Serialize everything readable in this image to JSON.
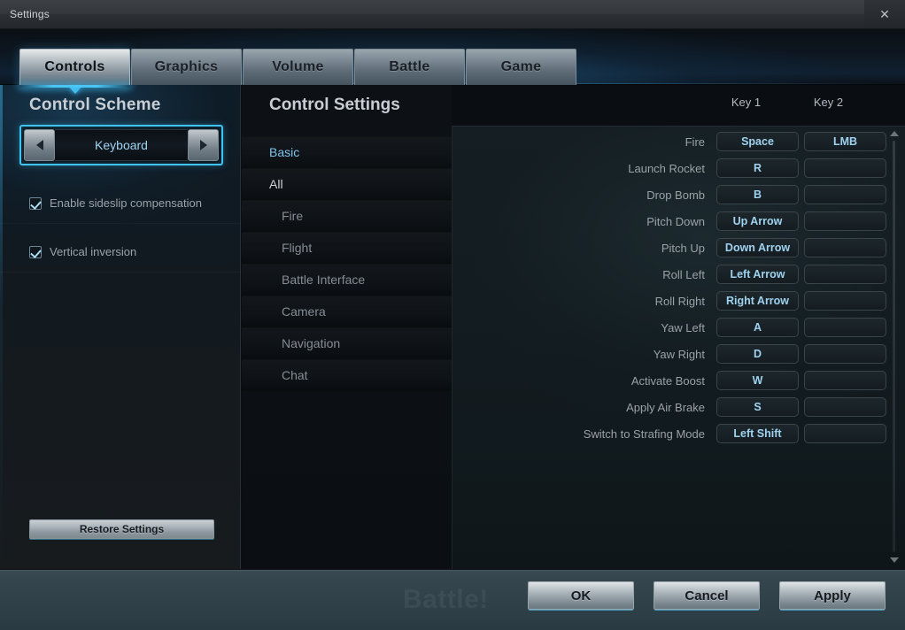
{
  "window": {
    "title": "Settings",
    "close_icon": "close-icon"
  },
  "tabs": [
    {
      "label": "Controls",
      "active": true
    },
    {
      "label": "Graphics",
      "active": false
    },
    {
      "label": "Volume",
      "active": false
    },
    {
      "label": "Battle",
      "active": false
    },
    {
      "label": "Game",
      "active": false
    }
  ],
  "sidebar": {
    "title": "Control Scheme",
    "scheme": {
      "value": "Keyboard",
      "prev_icon": "triangle-left-icon",
      "next_icon": "triangle-right-icon"
    },
    "checkboxes": [
      {
        "label": "Enable sideslip compensation",
        "checked": true
      },
      {
        "label": "Vertical inversion",
        "checked": true
      }
    ],
    "restore_label": "Restore Settings"
  },
  "categories": {
    "title": "Control Settings",
    "items": [
      {
        "label": "Basic",
        "state": "selected",
        "indent": false
      },
      {
        "label": "All",
        "state": "group",
        "indent": false
      },
      {
        "label": "Fire",
        "state": "normal",
        "indent": true
      },
      {
        "label": "Flight",
        "state": "normal",
        "indent": true
      },
      {
        "label": "Battle Interface",
        "state": "normal",
        "indent": true
      },
      {
        "label": "Camera",
        "state": "normal",
        "indent": true
      },
      {
        "label": "Navigation",
        "state": "normal",
        "indent": true
      },
      {
        "label": "Chat",
        "state": "normal",
        "indent": true
      }
    ]
  },
  "bindings": {
    "columns": [
      "Key 1",
      "Key 2"
    ],
    "rows": [
      {
        "action": "Fire",
        "key1": "Space",
        "key2": "LMB"
      },
      {
        "action": "Launch Rocket",
        "key1": "R",
        "key2": ""
      },
      {
        "action": "Drop Bomb",
        "key1": "B",
        "key2": ""
      },
      {
        "action": "Pitch Down",
        "key1": "Up Arrow",
        "key2": ""
      },
      {
        "action": "Pitch Up",
        "key1": "Down Arrow",
        "key2": ""
      },
      {
        "action": "Roll Left",
        "key1": "Left Arrow",
        "key2": ""
      },
      {
        "action": "Roll Right",
        "key1": "Right Arrow",
        "key2": ""
      },
      {
        "action": "Yaw Left",
        "key1": "A",
        "key2": ""
      },
      {
        "action": "Yaw Right",
        "key1": "D",
        "key2": ""
      },
      {
        "action": "Activate Boost",
        "key1": "W",
        "key2": ""
      },
      {
        "action": "Apply Air Brake",
        "key1": "S",
        "key2": ""
      },
      {
        "action": "Switch to Strafing Mode",
        "key1": "Left Shift",
        "key2": ""
      }
    ],
    "scroll_up_icon": "chevron-up-icon",
    "scroll_down_icon": "chevron-down-icon"
  },
  "footer": {
    "watermark": "Battle!",
    "buttons": [
      {
        "label": "OK"
      },
      {
        "label": "Cancel"
      },
      {
        "label": "Apply"
      }
    ]
  },
  "colors": {
    "accent_cyan": "#3ec3f2",
    "key_text": "#9fd2ef",
    "selected_category": "#7dc3ea"
  }
}
